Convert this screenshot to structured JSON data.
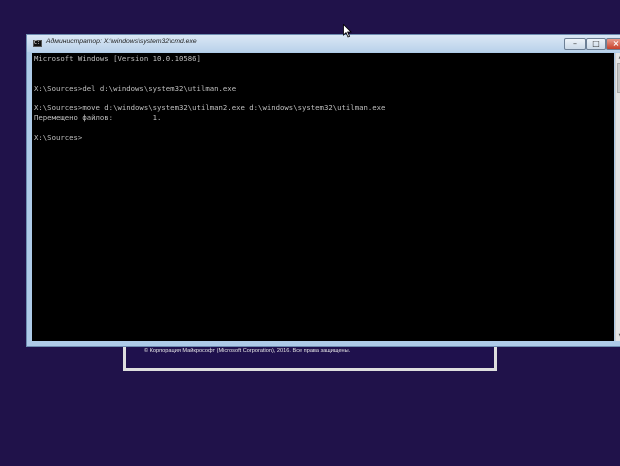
{
  "window": {
    "title": "Администратор: X:\\windows\\system32\\cmd.exe",
    "icon": "console-icon",
    "minimize_glyph": "–",
    "maximize_glyph": "□",
    "close_glyph": "×"
  },
  "console": {
    "lines": [
      "Microsoft Windows [Version 10.0.10586]",
      "",
      "",
      "X:\\Sources>del d:\\windows\\system32\\utilman.exe",
      "",
      "X:\\Sources>move d:\\windows\\system32\\utilman2.exe d:\\windows\\system32\\utilman.exe",
      "Перемещено файлов:         1.",
      "",
      "X:\\Sources>"
    ]
  },
  "setup": {
    "copyright": "© Корпорация Майкрософт (Microsoft Corporation), 2016. Все права защищены."
  },
  "colors": {
    "desktop": "#20124a",
    "console_bg": "#000000",
    "console_fg": "#c0c0c0"
  }
}
